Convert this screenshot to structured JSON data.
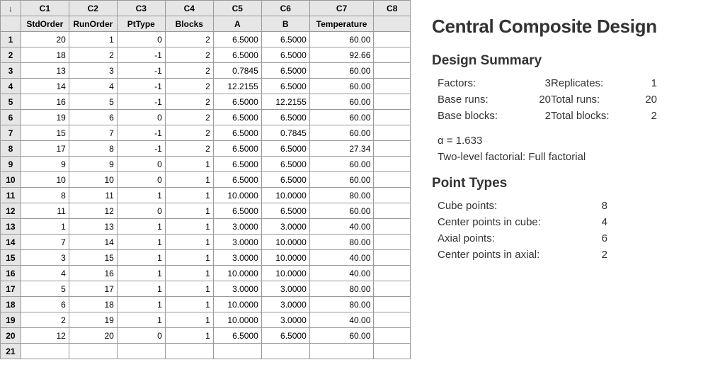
{
  "grid": {
    "corner": "↓",
    "col_headers": [
      "C1",
      "C2",
      "C3",
      "C4",
      "C5",
      "C6",
      "C7",
      "C8"
    ],
    "sub_headers": [
      "StdOrder",
      "RunOrder",
      "PtType",
      "Blocks",
      "A",
      "B",
      "Temperature",
      ""
    ],
    "rows": [
      [
        "20",
        "1",
        "0",
        "2",
        "6.5000",
        "6.5000",
        "60.00",
        ""
      ],
      [
        "18",
        "2",
        "-1",
        "2",
        "6.5000",
        "6.5000",
        "92.66",
        ""
      ],
      [
        "13",
        "3",
        "-1",
        "2",
        "0.7845",
        "6.5000",
        "60.00",
        ""
      ],
      [
        "14",
        "4",
        "-1",
        "2",
        "12.2155",
        "6.5000",
        "60.00",
        ""
      ],
      [
        "16",
        "5",
        "-1",
        "2",
        "6.5000",
        "12.2155",
        "60.00",
        ""
      ],
      [
        "19",
        "6",
        "0",
        "2",
        "6.5000",
        "6.5000",
        "60.00",
        ""
      ],
      [
        "15",
        "7",
        "-1",
        "2",
        "6.5000",
        "0.7845",
        "60.00",
        ""
      ],
      [
        "17",
        "8",
        "-1",
        "2",
        "6.5000",
        "6.5000",
        "27.34",
        ""
      ],
      [
        "9",
        "9",
        "0",
        "1",
        "6.5000",
        "6.5000",
        "60.00",
        ""
      ],
      [
        "10",
        "10",
        "0",
        "1",
        "6.5000",
        "6.5000",
        "60.00",
        ""
      ],
      [
        "8",
        "11",
        "1",
        "1",
        "10.0000",
        "10.0000",
        "80.00",
        ""
      ],
      [
        "11",
        "12",
        "0",
        "1",
        "6.5000",
        "6.5000",
        "60.00",
        ""
      ],
      [
        "1",
        "13",
        "1",
        "1",
        "3.0000",
        "3.0000",
        "40.00",
        ""
      ],
      [
        "7",
        "14",
        "1",
        "1",
        "3.0000",
        "10.0000",
        "80.00",
        ""
      ],
      [
        "3",
        "15",
        "1",
        "1",
        "3.0000",
        "10.0000",
        "40.00",
        ""
      ],
      [
        "4",
        "16",
        "1",
        "1",
        "10.0000",
        "10.0000",
        "40.00",
        ""
      ],
      [
        "5",
        "17",
        "1",
        "1",
        "3.0000",
        "3.0000",
        "80.00",
        ""
      ],
      [
        "6",
        "18",
        "1",
        "1",
        "10.0000",
        "3.0000",
        "80.00",
        ""
      ],
      [
        "2",
        "19",
        "1",
        "1",
        "10.0000",
        "3.0000",
        "40.00",
        ""
      ],
      [
        "12",
        "20",
        "0",
        "1",
        "6.5000",
        "6.5000",
        "60.00",
        ""
      ],
      [
        "",
        "",
        "",
        "",
        "",
        "",
        "",
        ""
      ]
    ]
  },
  "panel": {
    "title": "Central Composite Design",
    "design_summary_heading": "Design Summary",
    "summary": {
      "factors_label": "Factors:",
      "factors_val": "3",
      "replicates_label": "Replicates:",
      "replicates_val": "1",
      "baseruns_label": "Base runs:",
      "baseruns_val": "20",
      "totalruns_label": "Total runs:",
      "totalruns_val": "20",
      "baseblocks_label": "Base blocks:",
      "baseblocks_val": "2",
      "totalblocks_label": "Total blocks:",
      "totalblocks_val": "2"
    },
    "alpha": "α = 1.633",
    "factorial": "Two-level factorial: Full factorial",
    "point_types_heading": "Point Types",
    "points": {
      "cube_label": "Cube points:",
      "cube_val": "8",
      "cpcube_label": "Center points in cube:",
      "cpcube_val": "4",
      "axial_label": "Axial points:",
      "axial_val": "6",
      "cpaxial_label": "Center points in axial:",
      "cpaxial_val": "2"
    }
  }
}
